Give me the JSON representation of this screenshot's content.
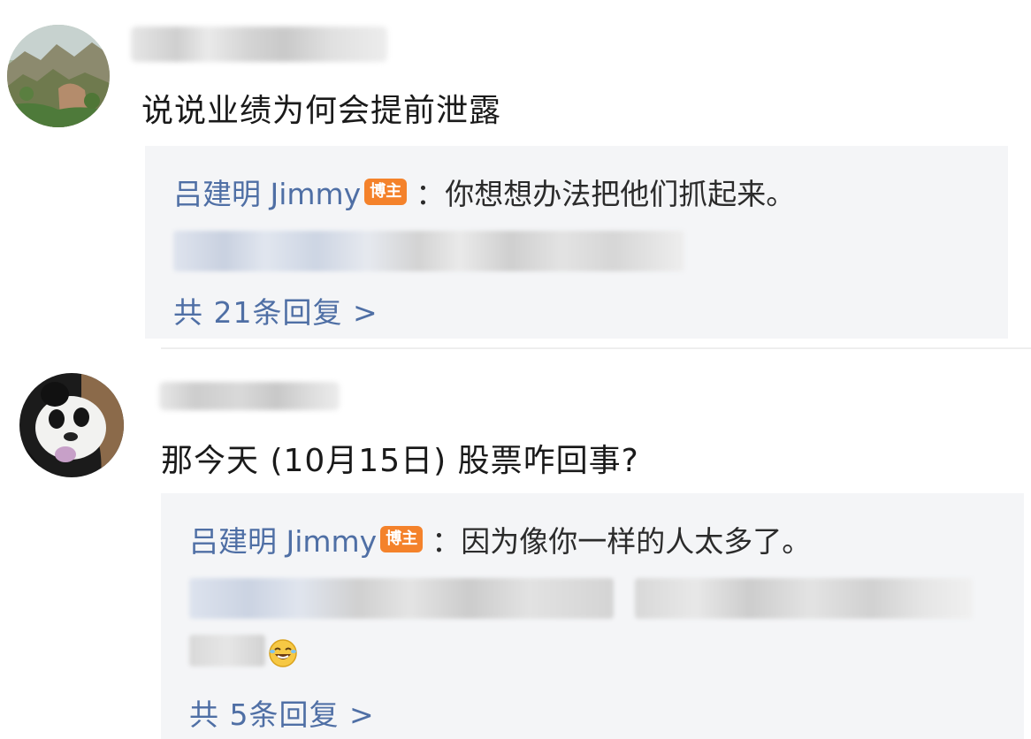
{
  "comments": [
    {
      "avatar": "landscape-avatar",
      "text": "说说业绩为何会提前泄露",
      "reply": {
        "author": "吕建明 Jimmy",
        "badge": "博主",
        "content": "：你想想办法把他们抓起来。",
        "more": "共 21条回复 >"
      }
    },
    {
      "avatar": "panda-avatar",
      "text": "那今天 (10月15日) 股票咋回事?",
      "reply": {
        "author": "吕建明 Jimmy",
        "badge": "博主",
        "content": "：因为像你一样的人太多了。",
        "more": "共 5条回复 >",
        "emoji": "laughing-emoji"
      }
    }
  ],
  "colors": {
    "link_blue": "#4f6fa5",
    "badge_orange": "#f4822b",
    "reply_bg": "#f4f5f7"
  }
}
